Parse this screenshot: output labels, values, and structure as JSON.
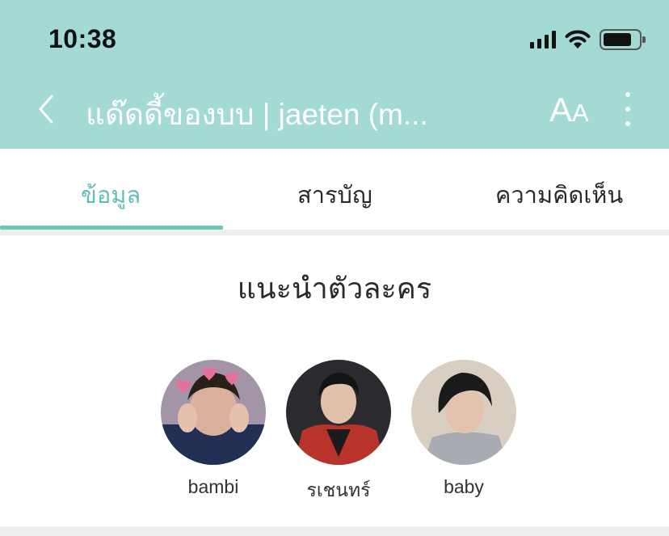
{
  "status_bar": {
    "time": "10:38"
  },
  "nav": {
    "title": "แด๊ดดี้ของบบ | jaeten (m...",
    "font_size_label_big": "A",
    "font_size_label_small": "A"
  },
  "tabs": [
    {
      "label": "ข้อมูล",
      "active": true
    },
    {
      "label": "สารบัญ",
      "active": false
    },
    {
      "label": "ความคิดเห็น",
      "active": false
    }
  ],
  "section": {
    "title": "แนะนำตัวละคร"
  },
  "characters": [
    {
      "name": "bambi"
    },
    {
      "name": "รเชนทร์"
    },
    {
      "name": "baby"
    }
  ],
  "colors": {
    "header_bg": "#a3dad4",
    "accent": "#5fbfb5"
  }
}
